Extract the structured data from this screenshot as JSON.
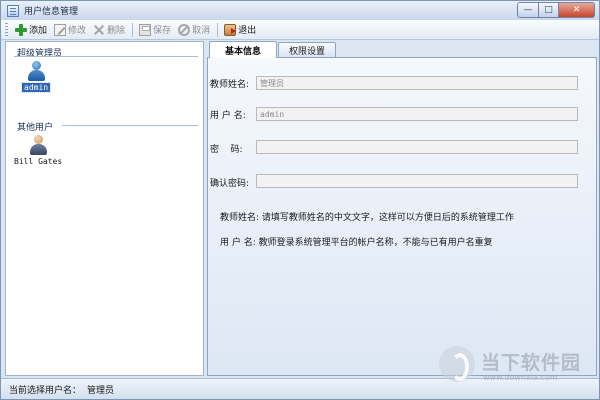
{
  "window": {
    "title": "用户信息管理",
    "controls": {
      "minimize": "—",
      "maximize": "□",
      "close": "✕"
    }
  },
  "toolbar": {
    "add_label": "添加",
    "edit_label": "修改",
    "delete_label": "删除",
    "save_label": "保存",
    "cancel_label": "取消",
    "exit_label": "退出"
  },
  "sidebar": {
    "groups": [
      {
        "title": "超级管理员",
        "users": [
          {
            "name": "admin",
            "selected": true
          }
        ]
      },
      {
        "title": "其他用户",
        "users": [
          {
            "name": "Bill Gates",
            "selected": false
          }
        ]
      }
    ]
  },
  "tabs": [
    {
      "label": "基本信息",
      "active": true
    },
    {
      "label": "权限设置",
      "active": false
    }
  ],
  "form": {
    "teacher_name": {
      "label": "教师姓名:",
      "value": "管理员"
    },
    "username": {
      "label": "用 户 名:",
      "value": "admin"
    },
    "password": {
      "label": "密    码:",
      "value": ""
    },
    "confirm_password": {
      "label": "确认密码:",
      "value": ""
    }
  },
  "hints": [
    "教师姓名: 请填写教师姓名的中文文字，这样可以方便日后的系统管理工作",
    "用 户 名: 教师登录系统管理平台的帐户名称，不能与已有用户名重复"
  ],
  "statusbar": {
    "label": "当前选择用户名：",
    "value": "管理员"
  },
  "watermark": {
    "name": "当下软件园",
    "url": "www.downxia.com"
  }
}
